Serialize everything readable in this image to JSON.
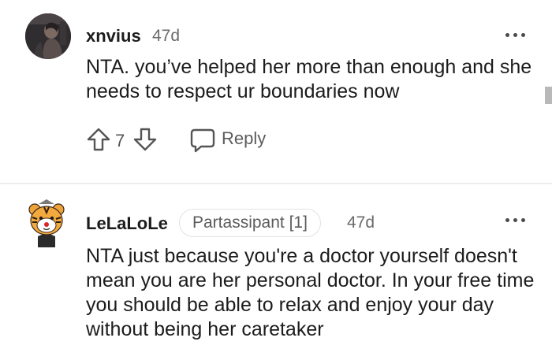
{
  "comments": [
    {
      "author": "xnvius",
      "age": "47d",
      "body": "NTA. you’ve helped her more than enough and she needs to respect ur boundaries now",
      "votes": "7",
      "reply_label": "Reply"
    },
    {
      "author": "LeLaLoLe",
      "flair": "Partassipant [1]",
      "age": "47d",
      "body": "NTA just because you're a doctor yourself doesn't mean you are her personal doctor. In your free time you should be able to relax and enjoy your day without being her caretaker"
    }
  ],
  "icons": {
    "upvote": "upvote-arrow-icon",
    "downvote": "downvote-arrow-icon",
    "reply": "speech-bubble-icon",
    "more": "three-dots-icon"
  },
  "colors": {
    "text": "#1c1c1c",
    "meta": "#6a6a6a",
    "icon": "#555555"
  }
}
